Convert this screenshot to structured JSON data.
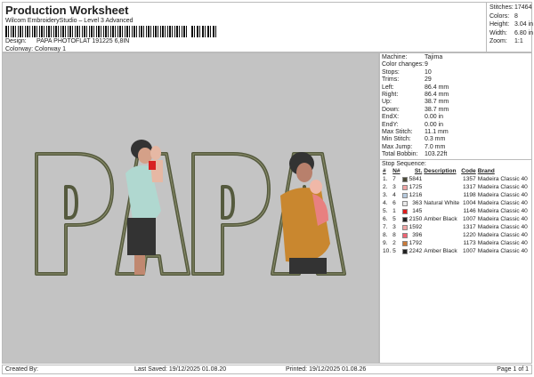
{
  "header": {
    "title": "Production Worksheet",
    "subtitle": "Wilcom EmbroideryStudio – Level 3 Advanced",
    "design_label": "Design:",
    "design_value": "PAPA PHOTOFLAT 191225 6,8IN",
    "colorway_label": "Colorway:",
    "colorway_value": "Colorway 1"
  },
  "stats": [
    {
      "label": "Stitches:",
      "value": "17464"
    },
    {
      "label": "Colors:",
      "value": "8"
    },
    {
      "label": "Height:",
      "value": "3.04 in"
    },
    {
      "label": "Width:",
      "value": "6.80 in"
    },
    {
      "label": "Zoom:",
      "value": "1:1"
    }
  ],
  "info": [
    {
      "label": "Machine:",
      "value": "Tajima"
    },
    {
      "label": "Color changes:",
      "value": "9"
    },
    {
      "label": "Stops:",
      "value": "10"
    },
    {
      "label": "Trims:",
      "value": "29"
    },
    {
      "label": "Left:",
      "value": "86.4 mm"
    },
    {
      "label": "Right:",
      "value": "86.4 mm"
    },
    {
      "label": "Up:",
      "value": "38.7 mm"
    },
    {
      "label": "Down:",
      "value": "38.7 mm"
    },
    {
      "label": "EndX:",
      "value": "0.00 in"
    },
    {
      "label": "EndY:",
      "value": "0.00 in"
    },
    {
      "label": "Max Stitch:",
      "value": "11.1 mm"
    },
    {
      "label": "Min Stitch:",
      "value": "0.3 mm"
    },
    {
      "label": "Max Jump:",
      "value": "7.0 mm"
    },
    {
      "label": "Total Bobbin:",
      "value": "103.22ft"
    }
  ],
  "sequence": {
    "title": "Stop Sequence:",
    "headers": [
      "#",
      "N#",
      "St.",
      "Description",
      "Code",
      "Brand"
    ],
    "rows": [
      {
        "n": "1.",
        "needle": "7",
        "color": "#4b4a38",
        "st": "5841",
        "desc": "",
        "code": "1357",
        "brand": "Madeira Classic 40"
      },
      {
        "n": "2.",
        "needle": "3",
        "color": "#f0a4a4",
        "st": "1725",
        "desc": "",
        "code": "1317",
        "brand": "Madeira Classic 40"
      },
      {
        "n": "3.",
        "needle": "4",
        "color": "#b6cade",
        "st": "1216",
        "desc": "",
        "code": "1198",
        "brand": "Madeira Classic 40"
      },
      {
        "n": "4.",
        "needle": "6",
        "color": "#e8e8e8",
        "st": "363",
        "desc": "Natural White",
        "code": "1004",
        "brand": "Madeira Classic 40"
      },
      {
        "n": "5.",
        "needle": "1",
        "color": "#dd1c1c",
        "st": "145",
        "desc": "",
        "code": "1146",
        "brand": "Madeira Classic 40"
      },
      {
        "n": "6.",
        "needle": "5",
        "color": "#222222",
        "st": "2150",
        "desc": "Amber Black",
        "code": "1007",
        "brand": "Madeira Classic 40"
      },
      {
        "n": "7.",
        "needle": "3",
        "color": "#f0a4a4",
        "st": "1592",
        "desc": "",
        "code": "1317",
        "brand": "Madeira Classic 40"
      },
      {
        "n": "8.",
        "needle": "8",
        "color": "#ee6474",
        "st": "396",
        "desc": "",
        "code": "1220",
        "brand": "Madeira Classic 40"
      },
      {
        "n": "9.",
        "needle": "2",
        "color": "#c97a3a",
        "st": "1792",
        "desc": "",
        "code": "1173",
        "brand": "Madeira Classic 40"
      },
      {
        "n": "10.",
        "needle": "5",
        "color": "#222222",
        "st": "2242",
        "desc": "Amber Black",
        "code": "1007",
        "brand": "Madeira Classic 40"
      }
    ]
  },
  "footer": {
    "created": "Created By:",
    "saved": "Last Saved: 19/12/2025 01.08.20",
    "printed": "Printed: 19/12/2025 01.08.26",
    "page": "Page 1 of 1"
  }
}
